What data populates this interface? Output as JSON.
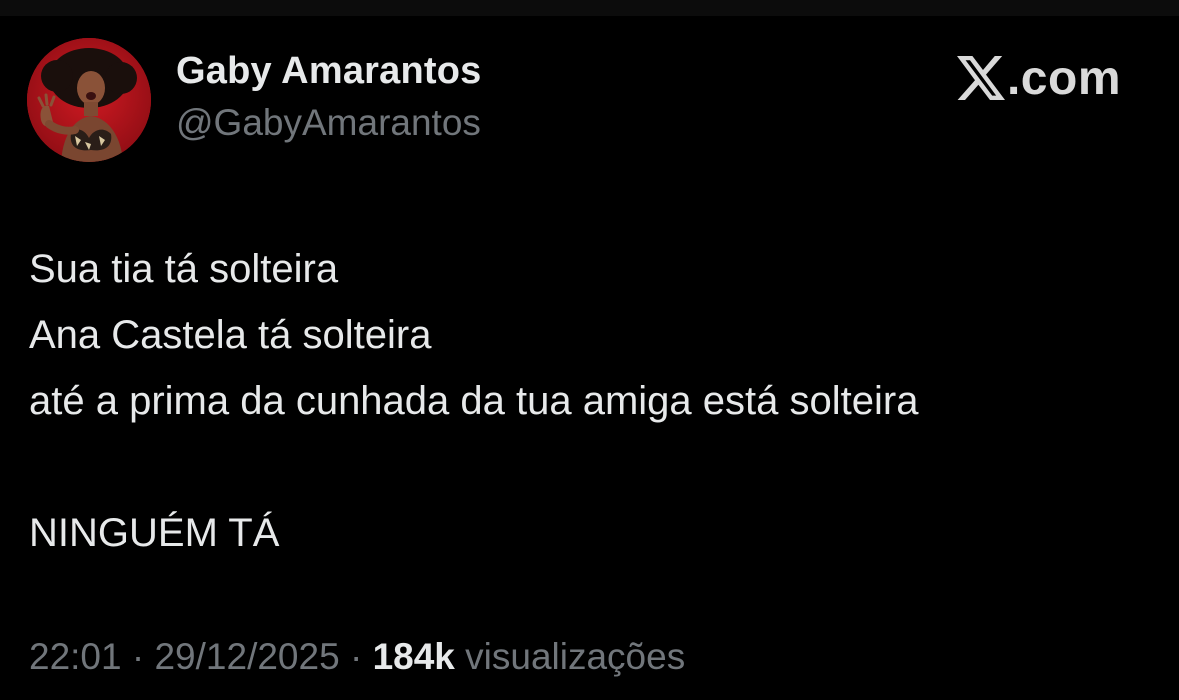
{
  "post": {
    "author": {
      "display_name": "Gaby Amarantos",
      "handle": "@GabyAmarantos",
      "avatar_icon": "profile-photo"
    },
    "brand": {
      "icon": "x-logo-icon",
      "domain": ".com"
    },
    "text_lines": [
      "Sua tia tá solteira",
      "Ana Castela tá solteira",
      "até a prima da cunhada da tua amiga está solteira",
      "",
      "NINGUÉM TÁ"
    ],
    "meta": {
      "time": "22:01",
      "separator": "·",
      "date": "29/12/2025",
      "views_count": "184k",
      "views_label": "visualizações"
    }
  },
  "colors": {
    "background": "#000000",
    "primary_text": "#e7e9ea",
    "secondary_text": "#71767b",
    "avatar_bg": "#b8121c"
  }
}
